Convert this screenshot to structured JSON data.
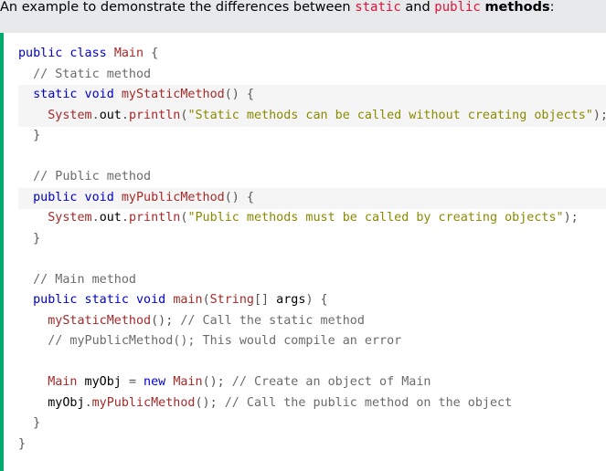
{
  "intro": {
    "prefix": "An example to demonstrate the differences between ",
    "word_static": "static",
    "and_text": " and ",
    "word_public": "public",
    "space": " ",
    "word_methods": "methods",
    "suffix": ":"
  },
  "code": {
    "l1_kw": "public class",
    "l1_cls": "Main",
    "l1_brace": " {",
    "l2_comment": "// Static method",
    "l3_kw": "static void",
    "l3_fn": "myStaticMethod",
    "l3_rest": "() {",
    "l4_sys": "System",
    "l4_dot1": ".",
    "l4_out": "out",
    "l4_dot2": ".",
    "l4_println": "println",
    "l4_open": "(",
    "l4_str": "\"Static methods can be called without creating objects\"",
    "l4_close": ");",
    "l5_brace": "}",
    "l7_comment": "// Public method",
    "l8_kw": "public void",
    "l8_fn": "myPublicMethod",
    "l8_rest": "() {",
    "l9_sys": "System",
    "l9_dot1": ".",
    "l9_out": "out",
    "l9_dot2": ".",
    "l9_println": "println",
    "l9_open": "(",
    "l9_str": "\"Public methods must be called by creating objects\"",
    "l9_close": ");",
    "l10_brace": "}",
    "l12_comment": "// Main method",
    "l13_kw": "public static void",
    "l13_fn": "main",
    "l13_open": "(",
    "l13_type": "String",
    "l13_arr": "[]",
    "l13_args": " args",
    "l13_rest": ") {",
    "l14_fn": "myStaticMethod",
    "l14_paren": "();",
    "l14_comment": " // Call the static method",
    "l15_comment": "// myPublicMethod(); This would compile an error",
    "l17_cls": "Main",
    "l17_var": " myObj ",
    "l17_eq": "=",
    "l17_new": " new ",
    "l17_cls2": "Main",
    "l17_paren": "();",
    "l17_comment": " // Create an object of Main",
    "l18_var": "myObj",
    "l18_dot": ".",
    "l18_fn": "myPublicMethod",
    "l18_paren": "();",
    "l18_comment": " // Call the public method on the object",
    "l19_brace": "}",
    "l20_brace": "}"
  }
}
